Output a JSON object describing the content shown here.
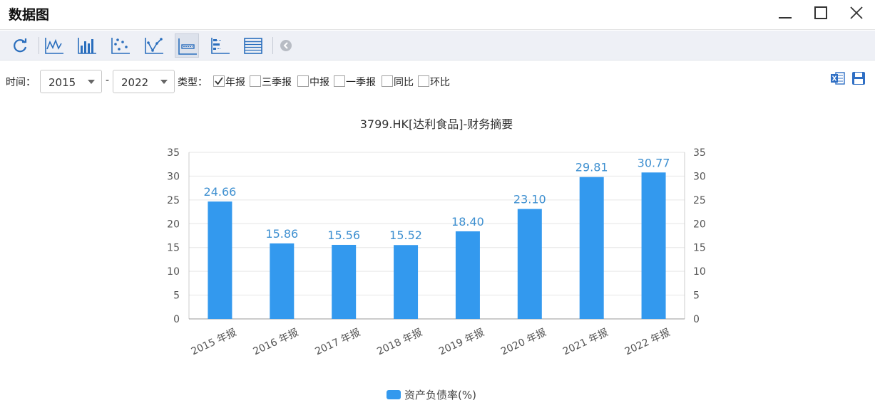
{
  "window": {
    "title": "数据图"
  },
  "filters": {
    "time_label": "时间：",
    "from_year": "2015",
    "range_sep": "-",
    "to_year": "2022",
    "type_label": "类型：",
    "options": [
      {
        "label": "年报",
        "checked": true
      },
      {
        "label": "三季报",
        "checked": false
      },
      {
        "label": "中报",
        "checked": false
      },
      {
        "label": "一季报",
        "checked": false
      },
      {
        "label": "同比",
        "checked": false
      },
      {
        "label": "环比",
        "checked": false
      }
    ]
  },
  "colors": {
    "bar": "#3399ee",
    "value_label": "#3d8fd0",
    "axis_text": "#555555",
    "grid": "#e6e6e6",
    "toolbar_icon": "#2a6ebd"
  },
  "icons": {
    "toolbar": [
      "refresh-icon",
      "line-chart-icon",
      "bar-chart-icon",
      "scatter-chart-icon",
      "line-point-chart-icon",
      "bar-series-icon",
      "horizontal-bar-icon",
      "table-icon",
      "collapse-icon"
    ],
    "export": "excel-icon",
    "save": "save-icon"
  },
  "chart_data": {
    "type": "bar",
    "title": "3799.HK[达利食品]-财务摘要",
    "categories": [
      "2015 年报",
      "2016 年报",
      "2017 年报",
      "2018 年报",
      "2019 年报",
      "2020 年报",
      "2021 年报",
      "2022 年报"
    ],
    "series": [
      {
        "name": "资产负债率(%)",
        "values": [
          24.66,
          15.86,
          15.56,
          15.52,
          18.4,
          23.1,
          29.81,
          30.77
        ]
      }
    ],
    "value_labels": [
      "24.66",
      "15.86",
      "15.56",
      "15.52",
      "18.40",
      "23.10",
      "29.81",
      "30.77"
    ],
    "yticks": [
      "0",
      "5",
      "10",
      "15",
      "20",
      "25",
      "30",
      "35"
    ],
    "ylim": [
      0,
      35
    ],
    "grid": true,
    "dual_y_axis": true,
    "legend_position": "bottom-center"
  }
}
